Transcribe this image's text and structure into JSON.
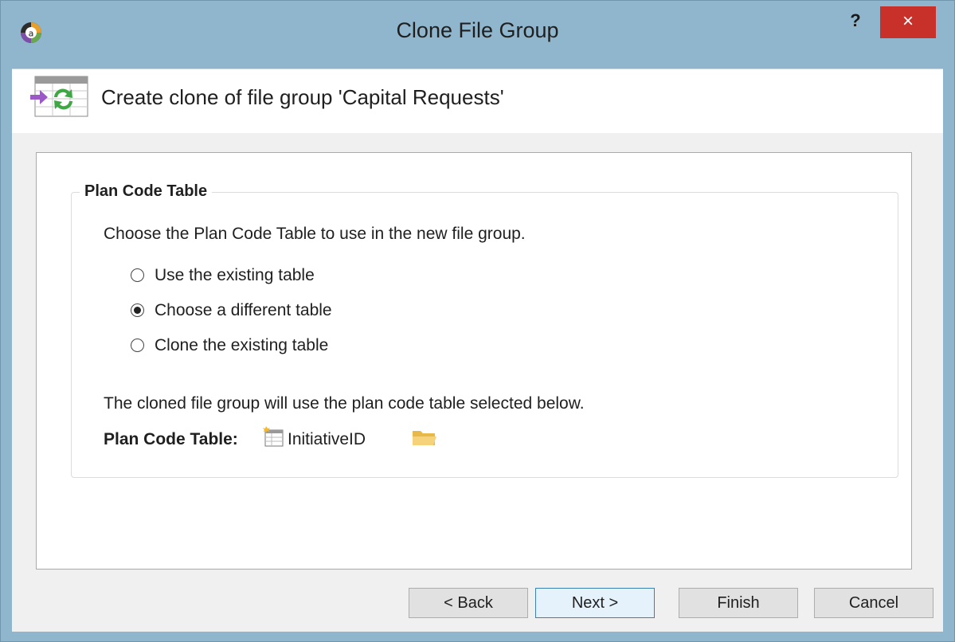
{
  "window": {
    "title": "Clone File Group",
    "help_label": "?",
    "close_label": "×"
  },
  "header": {
    "text": "Create clone of file group 'Capital Requests'"
  },
  "plan_code_group": {
    "legend": "Plan Code Table",
    "instruction": "Choose the Plan Code Table to use in the new file group.",
    "options": [
      {
        "label": "Use the existing table",
        "selected": false
      },
      {
        "label": "Choose a different table",
        "selected": true
      },
      {
        "label": "Clone the existing table",
        "selected": false
      }
    ],
    "note": "The cloned file group will use the plan code table selected below.",
    "table_label": "Plan Code Table:",
    "table_value": "InitiativeID",
    "icons": {
      "table": "table-icon",
      "browse": "folder-icon"
    }
  },
  "buttons": {
    "back": "< Back",
    "next": "Next >",
    "finish": "Finish",
    "cancel": "Cancel"
  },
  "colors": {
    "titlebar": "#8fb6cc",
    "close": "#c7312a",
    "accent": "#3c7fb1"
  }
}
